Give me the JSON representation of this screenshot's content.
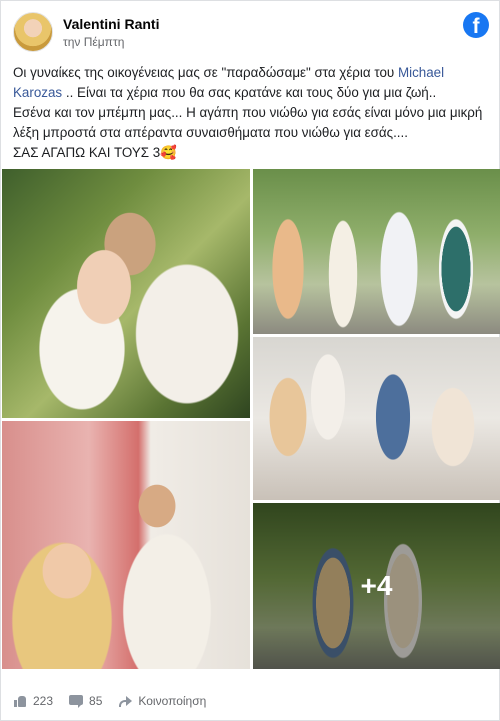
{
  "post": {
    "author": "Valentini Ranti",
    "time": "την Πέμπτη",
    "text_line1_part1": "Οι γυναίκες της οικογένειας μας σε \"παραδώσαμε\" στα χέρια του ",
    "tag_part1": "Michael",
    "tag_part2": "Karozas",
    "text_line2_rest": " .. Είναι τα χέρια που θα σας κρατάνε και τους δύο για μια ζωή..",
    "text_line3": "Εσένα και τον μπέμπη μας... Η αγάπη που νιώθω για εσάς είναι μόνο μια μικρή λέξη μπροστά στα απέραντα συναισθήματα που νιώθω για εσάς....",
    "text_line4": "ΣΑΣ ΑΓΑΠΩ ΚΑΙ ΤΟΥΣ 3🥰"
  },
  "brand": {
    "logo_letter": "f",
    "color": "#1877f2"
  },
  "photos": {
    "more_overlay": "+4"
  },
  "footer": {
    "likes": "223",
    "comments": "85",
    "share_label": "Κοινοποίηση"
  }
}
